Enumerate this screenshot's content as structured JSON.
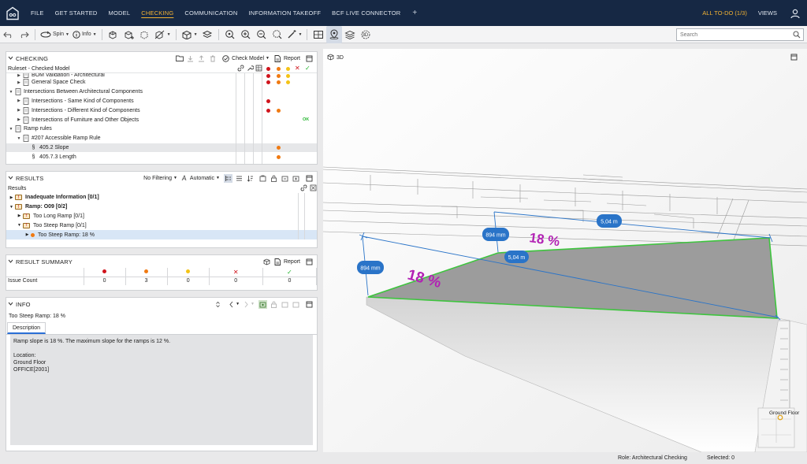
{
  "menu": {
    "items": [
      "FILE",
      "GET STARTED",
      "MODEL",
      "CHECKING",
      "COMMUNICATION",
      "INFORMATION TAKEOFF",
      "BCF LIVE CONNECTOR"
    ],
    "active": "CHECKING",
    "todo": "ALL TO-DO (1/3)",
    "views": "VIEWS"
  },
  "toolbar": {
    "spin_label": "Spin",
    "info_label": "Info",
    "search_placeholder": "Search"
  },
  "checking": {
    "title": "CHECKING",
    "check_model_label": "Check Model",
    "report_label": "Report",
    "ruleset_label": "Ruleset - Checked Model",
    "rows": [
      {
        "indent": 1,
        "label": "BOM Validation - Architectural",
        "marks": [
          "red",
          "orange",
          "yellow"
        ],
        "ok": "",
        "partial": true
      },
      {
        "indent": 1,
        "label": "General Space Check",
        "marks": [
          "red",
          "orange",
          "yellow"
        ],
        "ok": ""
      },
      {
        "indent": 0,
        "expanded": true,
        "label": "Intersections Between Architectural Components",
        "marks": [],
        "ok": ""
      },
      {
        "indent": 1,
        "label": "Intersections - Same Kind of Components",
        "marks": [
          "red"
        ],
        "ok": ""
      },
      {
        "indent": 1,
        "label": "Intersections - Different Kind of Components",
        "marks": [
          "red",
          "orange"
        ],
        "ok": ""
      },
      {
        "indent": 1,
        "label": "Intersections of Furniture and Other Objects",
        "marks": [],
        "ok": "OK"
      },
      {
        "indent": 0,
        "expanded": true,
        "label": "Ramp rules",
        "marks": [],
        "ok": ""
      },
      {
        "indent": 1,
        "expanded": true,
        "label": "#207 Accessible Ramp Rule",
        "marks": [],
        "ok": ""
      },
      {
        "indent": 2,
        "rule": true,
        "label": "405.2 Slope",
        "marks": [
          "orange"
        ],
        "ok": "",
        "selected": true
      },
      {
        "indent": 2,
        "rule": true,
        "label": "405.7.3 Length",
        "marks": [
          "orange"
        ],
        "ok": ""
      }
    ]
  },
  "results": {
    "title": "RESULTS",
    "filter_label": "No Filtering",
    "auto_label": "Automatic",
    "sub_label": "Results",
    "rows": [
      {
        "indent": 0,
        "label": "Inadequate Information [0/1]",
        "bold": true,
        "folder": true
      },
      {
        "indent": 0,
        "label": "Ramp: O09 [0/2]",
        "bold": true,
        "folder": true,
        "expanded": true
      },
      {
        "indent": 1,
        "label": "Too Long Ramp [0/1]",
        "bold": false,
        "folder": true
      },
      {
        "indent": 1,
        "label": "Too Steep Ramp [0/1]",
        "bold": false,
        "folder": true,
        "expanded": true
      },
      {
        "indent": 2,
        "label": "Too Steep Ramp: 18 %",
        "bold": false,
        "dot": "orange",
        "highlight": true
      }
    ]
  },
  "summary": {
    "title": "RESULT SUMMARY",
    "report_label": "Report",
    "row_label": "Issue Count",
    "counts": [
      "0",
      "3",
      "0",
      "0",
      "0"
    ]
  },
  "info": {
    "title": "INFO",
    "item_title": "Too Steep Ramp: 18 %",
    "tab_label": "Description",
    "description_lines": [
      "Ramp slope is 18 %. The maximum slope for the ramps is 12 %.",
      "",
      "Location:",
      "Ground Floor",
      "OFFICE[2001]"
    ]
  },
  "view3d": {
    "label": "3D",
    "dim_short": "894 mm",
    "dim_long": "5,04 m",
    "slope_text": "18 %",
    "floor_label": "Ground Floor"
  },
  "status": {
    "role": "Role: Architectural Checking",
    "selected": "Selected: 0"
  },
  "colors": {
    "menubar": "#162844",
    "accent": "#f2b233",
    "red": "#d0141c",
    "orange": "#f07a12",
    "yellow": "#f4c316",
    "green": "#26b530",
    "dim_blue": "#2a74c8",
    "slope_magenta": "#b222b4"
  }
}
